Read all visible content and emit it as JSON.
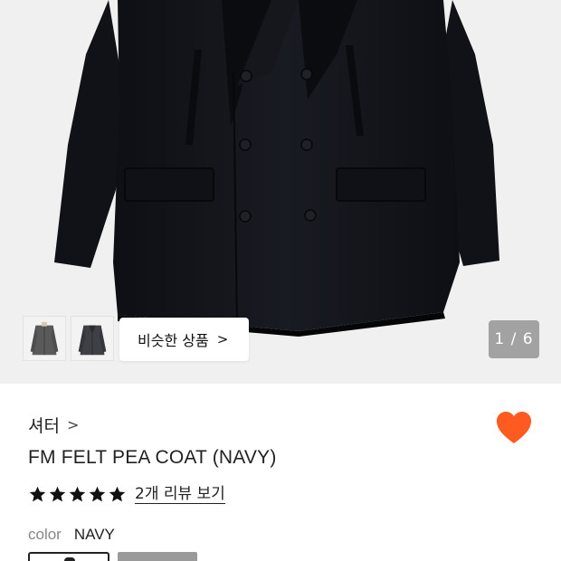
{
  "gallery": {
    "similar_label": "비슷한 상품",
    "similar_chevron": ">",
    "counter": "1 / 6",
    "thumbnails": [
      {
        "name": "thumbnail-gray-coat",
        "icon": "coat-thumbnail-gray"
      },
      {
        "name": "thumbnail-charcoal-coat",
        "icon": "coat-thumbnail-charcoal"
      }
    ]
  },
  "product": {
    "brand": "셔터",
    "brand_chevron": ">",
    "title": "FM FELT PEA COAT (NAVY)",
    "rating": {
      "stars": 5,
      "max": 5,
      "review_link": "2개 리뷰 보기"
    },
    "color_label": "color",
    "color_value": "NAVY",
    "wishlist_icon": "heart-icon"
  },
  "colors": {
    "accent_heart": "#ff5a1f",
    "star": "#111111",
    "hero_background": "#f0f0f0",
    "coat": "#14161c"
  }
}
